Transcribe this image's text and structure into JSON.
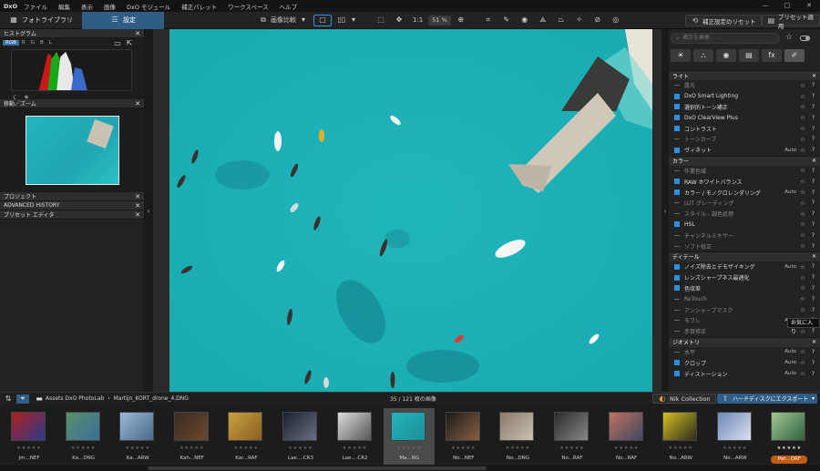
{
  "menubar": {
    "logo": "DxO",
    "items": [
      "ファイル",
      "編集",
      "表示",
      "画像",
      "DxO モジュール",
      "補正パレット",
      "ワークスペース",
      "ヘルプ"
    ],
    "window_controls": [
      "—",
      "□",
      "✕"
    ]
  },
  "toolbar": {
    "tab_library": "フォトライブラリ",
    "tab_edit": "設定",
    "compare": "画像比較",
    "zoom_1to1": "1:1",
    "zoom": "51 %",
    "reset": "補正設定のリセット",
    "apply_preset": "プリセット適用"
  },
  "left_panel": {
    "histogram": "ヒストグラム",
    "channels": [
      "RGB",
      "R",
      "G",
      "B",
      "L"
    ],
    "nav": "移動／ズーム",
    "project": "プロジェクト",
    "history": "ADVANCED HISTORY",
    "preset_editor": "プリセット エディタ"
  },
  "right_panel": {
    "search_placeholder": "補正を検索 . . .",
    "categories": [
      "☀",
      "⛬",
      "◉",
      "▤",
      "fx",
      "✐"
    ],
    "sections": [
      {
        "title": "ライト",
        "rows": [
          {
            "label": "露光",
            "on": false,
            "auto": ""
          },
          {
            "label": "DxO Smart Lighting",
            "on": true,
            "auto": ""
          },
          {
            "label": "選択的トーン補正",
            "on": true,
            "auto": ""
          },
          {
            "label": "DxO ClearView Plus",
            "on": true,
            "auto": ""
          },
          {
            "label": "コントラスト",
            "on": true,
            "auto": ""
          },
          {
            "label": "トーンカーブ",
            "on": false,
            "auto": ""
          },
          {
            "label": "ヴィネット",
            "on": true,
            "auto": "Auto"
          }
        ]
      },
      {
        "title": "カラー",
        "rows": [
          {
            "label": "作業色域",
            "on": false,
            "auto": ""
          },
          {
            "label": "RAW ホワイトバランス",
            "on": true,
            "auto": ""
          },
          {
            "label": "カラー / モノクロレンダリング",
            "on": true,
            "auto": "Auto"
          },
          {
            "label": "LUT グレーディング",
            "on": false,
            "auto": ""
          },
          {
            "label": "スタイル - 調色処理",
            "on": false,
            "auto": ""
          },
          {
            "label": "HSL",
            "on": true,
            "auto": ""
          },
          {
            "label": "チャンネルミキサー",
            "on": false,
            "auto": ""
          },
          {
            "label": "ソフト校正",
            "on": false,
            "auto": ""
          }
        ]
      },
      {
        "title": "ディテール",
        "rows": [
          {
            "label": "ノイズ除去とデモザイキング",
            "on": true,
            "auto": "Auto"
          },
          {
            "label": "レンズシャープネス最適化",
            "on": true,
            "auto": ""
          },
          {
            "label": "色収差",
            "on": true,
            "auto": ""
          },
          {
            "label": "ReTouch",
            "on": false,
            "auto": ""
          },
          {
            "label": "アンシャープマスク",
            "on": false,
            "auto": ""
          },
          {
            "label": "モワレ",
            "on": false,
            "auto": "Auto"
          },
          {
            "label": "赤目修正",
            "on": false,
            "auto": ""
          }
        ]
      },
      {
        "title": "ジオメトリ",
        "rows": [
          {
            "label": "水平",
            "on": false,
            "auto": "Auto"
          },
          {
            "label": "クロップ",
            "on": true,
            "auto": "Auto"
          },
          {
            "label": "ディストーション",
            "on": true,
            "auto": "Auto"
          }
        ]
      }
    ],
    "tooltip": "お気に入り"
  },
  "filmstrip": {
    "path_root": "Assets DxO PhotoLab",
    "path_file": "Martijn_KORT_drone_4.DNG",
    "count": "35 / 121 枚の画像",
    "nik": "Nik Collection",
    "export": "ハードディスクにエクスポート",
    "thumbs": [
      {
        "cap": "Jm...NEF",
        "c1": "#b02020",
        "c2": "#2a3a8a"
      },
      {
        "cap": "Ka...DNG",
        "c1": "#5a8f6a",
        "c2": "#3a6f9a"
      },
      {
        "cap": "Ka...ARW",
        "c1": "#9ab8d8",
        "c2": "#4a6a8a"
      },
      {
        "cap": "Kah...NEF",
        "c1": "#3a2a20",
        "c2": "#6a4a30"
      },
      {
        "cap": "Kar...RAF",
        "c1": "#c8a040",
        "c2": "#8a6020"
      },
      {
        "cap": "Lae....CR3",
        "c1": "#1a2030",
        "c2": "#6a7080"
      },
      {
        "cap": "Lae....CR2",
        "c1": "#ddd",
        "c2": "#555"
      },
      {
        "cap": "Ma...NG",
        "c1": "#24b4ba",
        "c2": "#1a8f98"
      },
      {
        "cap": "No...NEF",
        "c1": "#1a1a1a",
        "c2": "#8a6040"
      },
      {
        "cap": "No...DNG",
        "c1": "#8a7a6a",
        "c2": "#c8c0b0"
      },
      {
        "cap": "No...RAF",
        "c1": "#2a2a2a",
        "c2": "#888"
      },
      {
        "cap": "No...RAF",
        "c1": "#c07060",
        "c2": "#404860"
      },
      {
        "cap": "No...ARW",
        "c1": "#d8c020",
        "c2": "#2a2a20"
      },
      {
        "cap": "No...ARW",
        "c1": "#6a8ab8",
        "c2": "#dde"
      },
      {
        "cap": "Pet...ORF",
        "c1": "#a0c890",
        "c2": "#306040"
      }
    ]
  }
}
